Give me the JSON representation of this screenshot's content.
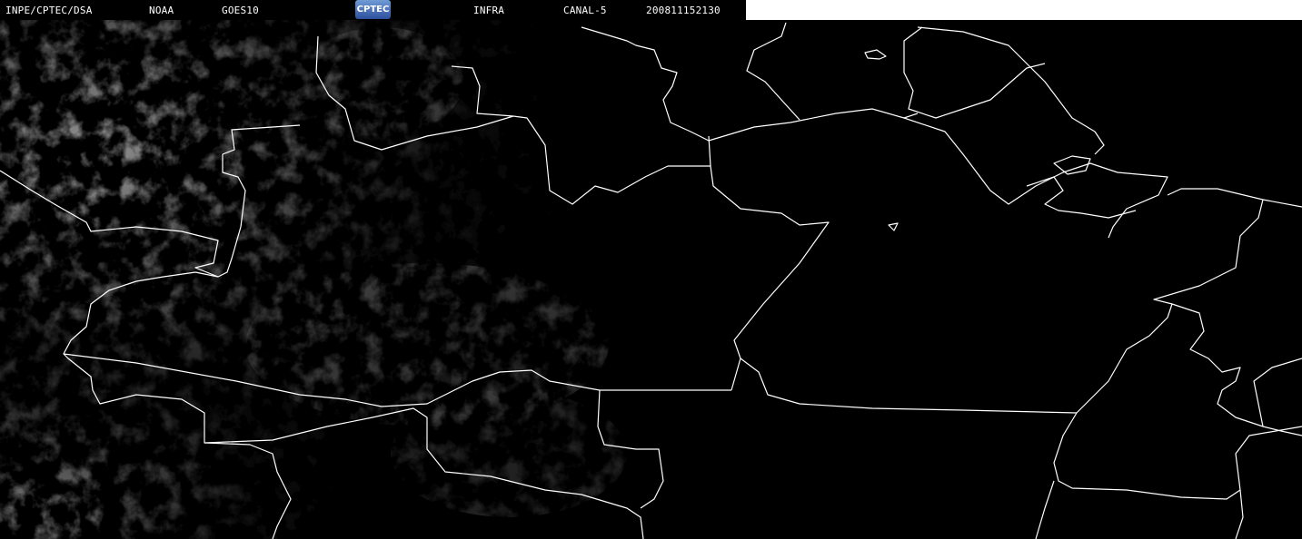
{
  "header": {
    "institution": "INPE/CPTEC/DSA",
    "agency": "NOAA",
    "satellite": "GOES10",
    "logo_text": "CPTEC",
    "product": "INFRA",
    "channel": "CANAL-5",
    "timestamp": "200811152130"
  },
  "colors": {
    "background": "#000000",
    "border_lines": "#ffffff",
    "cloud_gray": "#8a8a8a"
  }
}
